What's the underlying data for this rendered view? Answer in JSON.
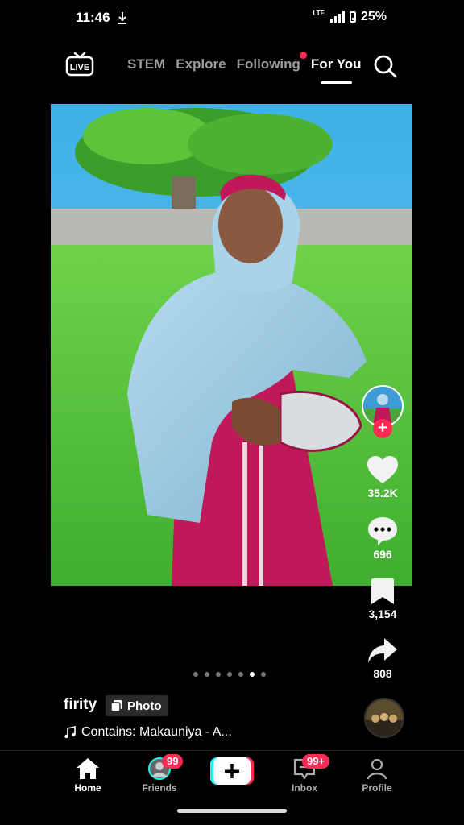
{
  "status": {
    "time": "11:46",
    "network": "LTE",
    "battery": "25%"
  },
  "top_nav": {
    "live_label": "LIVE",
    "tabs": [
      {
        "label": "STEM"
      },
      {
        "label": "Explore"
      },
      {
        "label": "Following"
      },
      {
        "label": "For You"
      }
    ]
  },
  "post": {
    "likes": "35.2K",
    "comments": "696",
    "saves": "3,154",
    "shares": "808",
    "author": "firity",
    "type_tag": "Photo",
    "music": "Contains: Makauniya - A...",
    "photo_count": 7,
    "photo_index": 6
  },
  "bottom_nav": {
    "home": "Home",
    "friends": "Friends",
    "friends_badge": "99",
    "inbox": "Inbox",
    "inbox_badge": "99+",
    "profile": "Profile"
  },
  "colors": {
    "accent": "#fe2c55",
    "comment": "#ffffff",
    "create_left": "#25f4ee",
    "create_right": "#fe2c55"
  }
}
